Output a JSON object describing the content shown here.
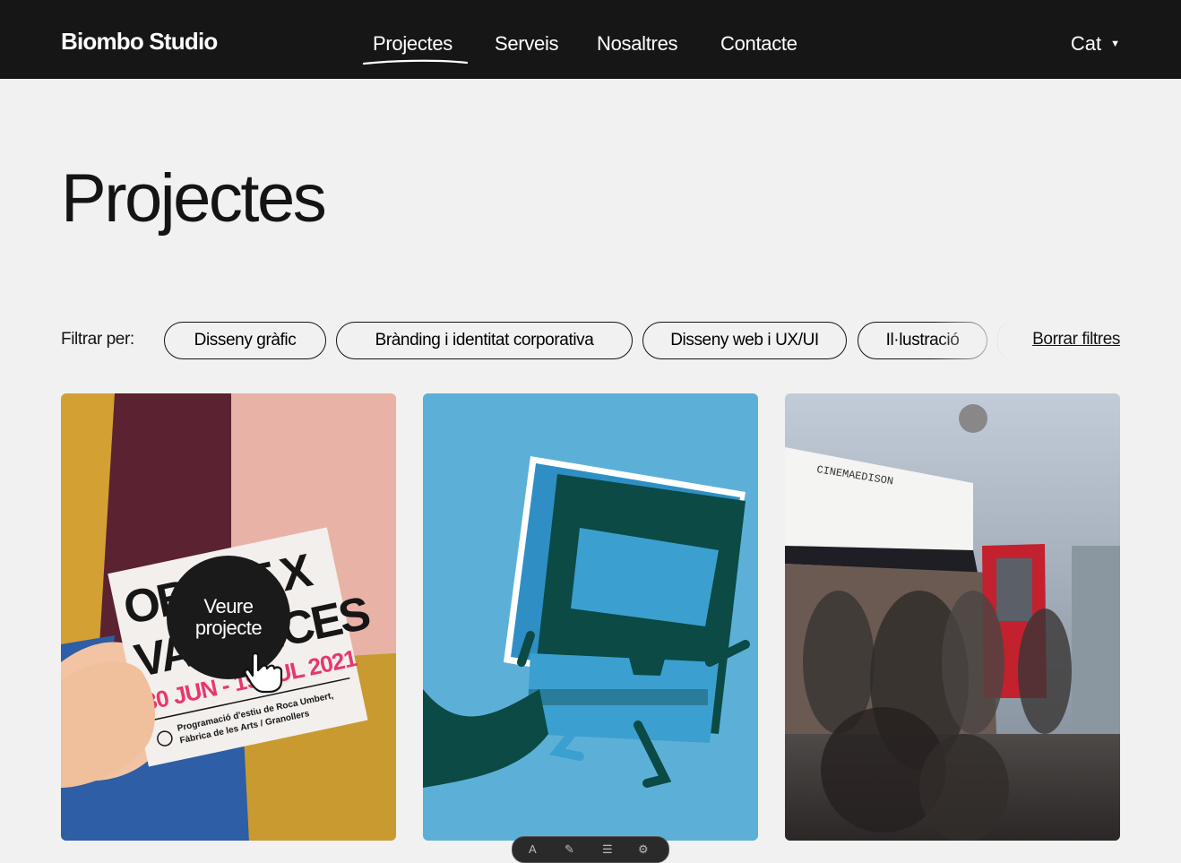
{
  "header": {
    "brand": "Biombo Studio",
    "nav": [
      {
        "label": "Projectes",
        "active": true
      },
      {
        "label": "Serveis",
        "active": false
      },
      {
        "label": "Nosaltres",
        "active": false
      },
      {
        "label": "Contacte",
        "active": false
      }
    ],
    "language": "Cat",
    "language_caret": "▼"
  },
  "main": {
    "title": "Projectes",
    "filters": {
      "label": "Filtrar per:",
      "chips": [
        "Disseny gràfic",
        "Brànding i identitat corporativa",
        "Disseny web i UX/UI",
        "Il·lustració"
      ],
      "clear_label": "Borrar filtres"
    },
    "cards": [
      {
        "poster_line1": "OBERT X",
        "poster_line2": "VACANCES",
        "poster_dates": "30 JUN - 19 JUL 2021",
        "poster_sub1": "Programació d'estiu de Roca Umbert,",
        "poster_sub2": "Fàbrica de les Arts  /  Granollers",
        "hover_label_1": "Veure",
        "hover_label_2": "projecte"
      },
      {},
      {
        "sign": "CINEMAEDISON"
      }
    ]
  },
  "colors": {
    "header_bg": "#161616",
    "page_bg": "#f1f1f1",
    "text": "#141414",
    "illustration_blue": "#5cb0d8",
    "illustration_dark": "#0b4a45"
  }
}
